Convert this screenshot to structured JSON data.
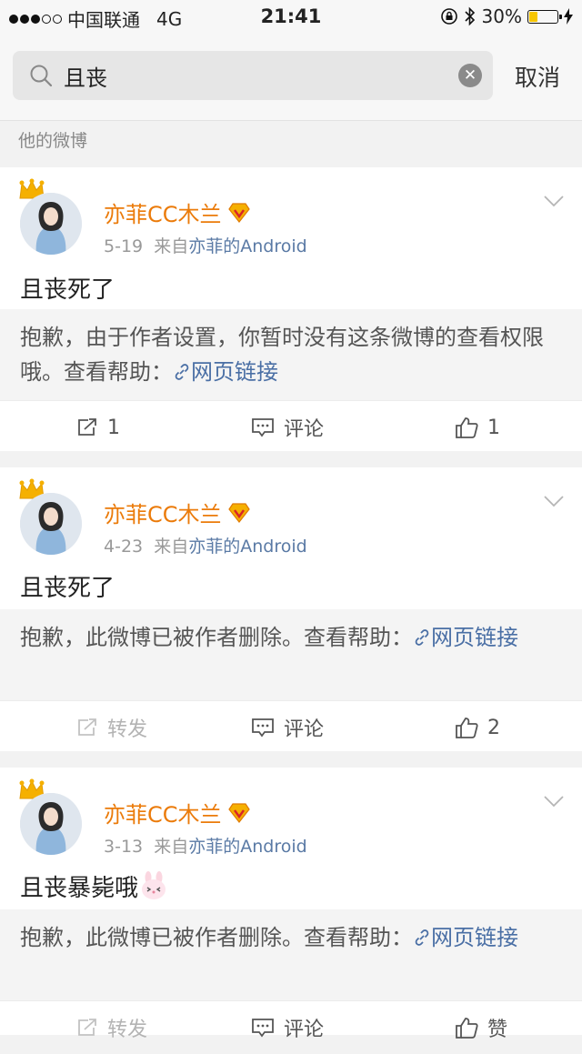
{
  "status_bar": {
    "carrier": "中国联通",
    "network": "4G",
    "time": "21:41",
    "battery": "30%",
    "battery_level": 0.3,
    "battery_color": "#f7c600"
  },
  "search": {
    "query": "且丧",
    "cancel_label": "取消"
  },
  "section_label": "他的微博",
  "accent_color": "#eb7b0a",
  "posts": [
    {
      "author": "亦菲CC木兰",
      "date": "5-19",
      "source_prefix": "来自",
      "source": "亦菲的Android",
      "text": "且丧死了",
      "notice": "抱歉，由于作者设置，你暂时没有这条微博的查看权限哦。查看帮助：",
      "link": "网页链接",
      "repost": "1",
      "comment": "评论",
      "like": "1"
    },
    {
      "author": "亦菲CC木兰",
      "date": "4-23",
      "source_prefix": "来自",
      "source": "亦菲的Android",
      "text": "且丧死了",
      "notice": "抱歉，此微博已被作者删除。查看帮助：",
      "link": "网页链接",
      "repost": "转发",
      "comment": "评论",
      "like": "2"
    },
    {
      "author": "亦菲CC木兰",
      "date": "3-13",
      "source_prefix": "来自",
      "source": "亦菲的Android",
      "text": "且丧暴毙哦",
      "notice": "抱歉，此微博已被作者删除。查看帮助：",
      "link": "网页链接",
      "repost": "转发",
      "comment": "评论",
      "like": "赞"
    }
  ]
}
